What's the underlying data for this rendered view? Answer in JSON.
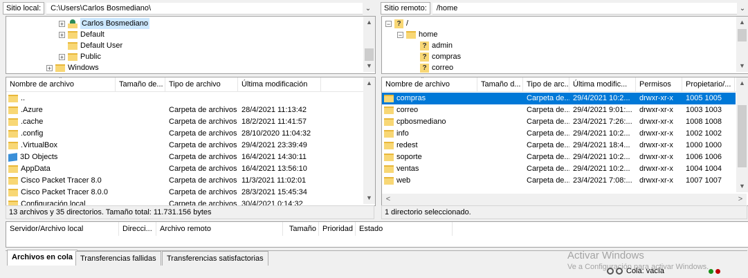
{
  "local": {
    "label": "Sitio local:",
    "path": "C:\\Users\\Carlos Bosmediano\\",
    "tree": [
      {
        "label": "Carlos Bosmediano",
        "icon": "user-folder-icon"
      },
      {
        "label": "Default"
      },
      {
        "label": "Default User"
      },
      {
        "label": "Public"
      },
      {
        "label": "Windows"
      }
    ],
    "columns": [
      "Nombre de archivo",
      "Tamaño de...",
      "Tipo de archivo",
      "Última modificación"
    ],
    "rows": [
      {
        "name": "..",
        "type": "",
        "modified": ""
      },
      {
        "name": ".Azure",
        "type": "Carpeta de archivos",
        "modified": "28/4/2021 11:13:42"
      },
      {
        "name": ".cache",
        "type": "Carpeta de archivos",
        "modified": "18/2/2021 11:41:57"
      },
      {
        "name": ".config",
        "type": "Carpeta de archivos",
        "modified": "28/10/2020 11:04:32"
      },
      {
        "name": ".VirtualBox",
        "type": "Carpeta de archivos",
        "modified": "29/4/2021 23:39:49"
      },
      {
        "name": "3D Objects",
        "type": "Carpeta de archivos",
        "modified": "16/4/2021 14:30:11"
      },
      {
        "name": "AppData",
        "type": "Carpeta de archivos",
        "modified": "16/4/2021 13:56:10"
      },
      {
        "name": "Cisco Packet Tracer 8.0",
        "type": "Carpeta de archivos",
        "modified": "11/3/2021 11:02:01"
      },
      {
        "name": "Cisco Packet Tracer 8.0.0",
        "type": "Carpeta de archivos",
        "modified": "28/3/2021 15:45:34"
      },
      {
        "name": "Configuración local",
        "type": "Carpeta de archivos",
        "modified": "30/4/2021 0:14:32"
      }
    ],
    "status": "13 archivos y 35 directorios. Tamaño total: 11.731.156 bytes"
  },
  "remote": {
    "label": "Sitio remoto:",
    "path": "/home",
    "tree": [
      {
        "label": "/"
      },
      {
        "label": "home"
      },
      {
        "label": "admin"
      },
      {
        "label": "compras"
      },
      {
        "label": "correo"
      }
    ],
    "columns": [
      "Nombre de archivo",
      "Tamaño d...",
      "Tipo de arc...",
      "Última modific...",
      "Permisos",
      "Propietario/..."
    ],
    "rows": [
      {
        "name": "compras",
        "type": "Carpeta de...",
        "modified": "29/4/2021 10:2...",
        "perms": "drwxr-xr-x",
        "owner": "1005 1005"
      },
      {
        "name": "correo",
        "type": "Carpeta de...",
        "modified": "29/4/2021 9:01:...",
        "perms": "drwxr-xr-x",
        "owner": "1003 1003"
      },
      {
        "name": "cpbosmediano",
        "type": "Carpeta de...",
        "modified": "23/4/2021 7:26:...",
        "perms": "drwxr-xr-x",
        "owner": "1008 1008"
      },
      {
        "name": "info",
        "type": "Carpeta de...",
        "modified": "29/4/2021 10:2...",
        "perms": "drwxr-xr-x",
        "owner": "1002 1002"
      },
      {
        "name": "redest",
        "type": "Carpeta de...",
        "modified": "29/4/2021 18:4...",
        "perms": "drwxr-xr-x",
        "owner": "1000 1000"
      },
      {
        "name": "soporte",
        "type": "Carpeta de...",
        "modified": "29/4/2021 10:2...",
        "perms": "drwxr-xr-x",
        "owner": "1006 1006"
      },
      {
        "name": "ventas",
        "type": "Carpeta de...",
        "modified": "29/4/2021 10:2...",
        "perms": "drwxr-xr-x",
        "owner": "1004 1004"
      },
      {
        "name": "web",
        "type": "Carpeta de...",
        "modified": "23/4/2021 7:08:...",
        "perms": "drwxr-xr-x",
        "owner": "1007 1007"
      }
    ],
    "status": "1 directorio seleccionado."
  },
  "queue": {
    "columns": [
      "Servidor/Archivo local",
      "Direcci...",
      "Archivo remoto",
      "Tamaño",
      "Prioridad",
      "Estado"
    ],
    "tabs": [
      "Archivos en cola",
      "Transferencias fallidas",
      "Transferencias satisfactorias"
    ],
    "status": "Cola: vacía"
  },
  "watermark": {
    "title": "Activar Windows",
    "subtitle": "Ve a Configuración para activar Windows."
  },
  "colors": {
    "selection": "#0078d7",
    "folder": "#f8d775"
  }
}
